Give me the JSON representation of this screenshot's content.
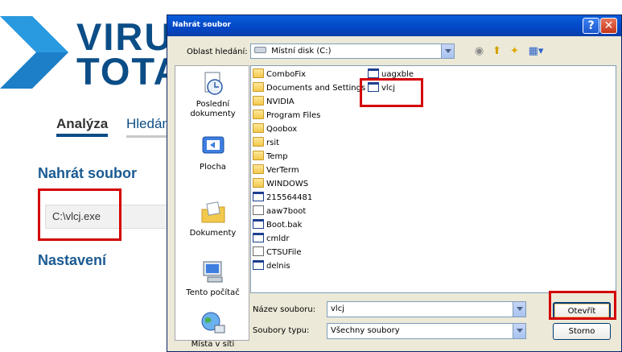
{
  "webpage": {
    "logo_word1": "VIRU",
    "logo_word2": "TOTA",
    "tab_analysis": "Analýza",
    "tab_search": "Hledán",
    "upload_heading": "Nahrát soubor",
    "file_path": "C:\\vlcj.exe",
    "settings_heading": "Nastavení"
  },
  "dialog": {
    "title": "Nahrát soubor",
    "help_glyph": "?",
    "close_glyph": "✕",
    "lookin_label": "Oblast hledání:",
    "lookin_value": "Místní disk (C:)",
    "places": [
      {
        "label": "Poslední dokumenty",
        "icon": "recent-documents-icon"
      },
      {
        "label": "Plocha",
        "icon": "desktop-icon"
      },
      {
        "label": "Dokumenty",
        "icon": "my-documents-icon"
      },
      {
        "label": "Tento počítač",
        "icon": "my-computer-icon"
      },
      {
        "label": "Místa v síti",
        "icon": "network-places-icon"
      }
    ],
    "files_col1": [
      {
        "name": "ComboFix",
        "type": "folder"
      },
      {
        "name": "Documents and Settings",
        "type": "folder"
      },
      {
        "name": "NVIDIA",
        "type": "folder"
      },
      {
        "name": "Program Files",
        "type": "folder"
      },
      {
        "name": "Qoobox",
        "type": "folder"
      },
      {
        "name": "rsit",
        "type": "folder"
      },
      {
        "name": "Temp",
        "type": "folder"
      },
      {
        "name": "VerTerm",
        "type": "folder"
      },
      {
        "name": "WINDOWS",
        "type": "folder"
      },
      {
        "name": "215564481",
        "type": "exe"
      },
      {
        "name": "aaw7boot",
        "type": "file"
      },
      {
        "name": "Boot.bak",
        "type": "exe"
      },
      {
        "name": "cmldr",
        "type": "exe"
      },
      {
        "name": "CTSUFile",
        "type": "file"
      },
      {
        "name": "delnis",
        "type": "exe"
      }
    ],
    "files_col2": [
      {
        "name": "uagxble",
        "type": "exe"
      },
      {
        "name": "vlcj",
        "type": "exe"
      }
    ],
    "filename_label": "Název souboru:",
    "filename_value": "vlcj",
    "filetype_label": "Soubory typu:",
    "filetype_value": "Všechny soubory",
    "open_label": "Otevřít",
    "cancel_label": "Storno"
  },
  "colors": {
    "highlight_box": "#d40000",
    "brand_blue": "#0b4d86",
    "titlebar": "#0246c6"
  }
}
